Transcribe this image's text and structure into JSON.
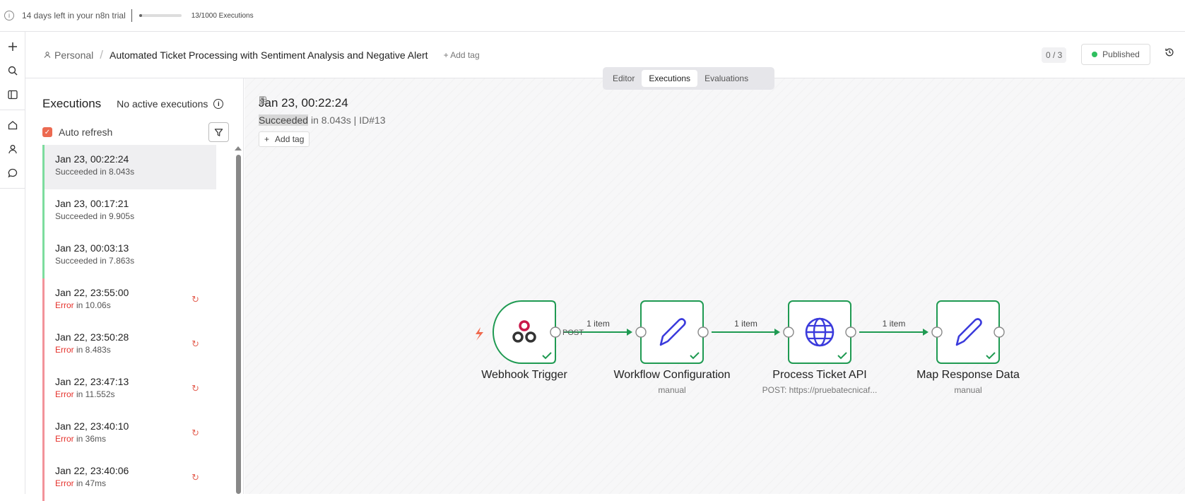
{
  "trial": {
    "message": "14 days left in your n8n trial",
    "executions_used": 13,
    "executions_limit": 1000,
    "executions_text": "13/1000 Executions"
  },
  "rail": {
    "icons": [
      "plus-icon",
      "search-icon",
      "panel-icon",
      "home-icon",
      "user-icon",
      "chat-icon"
    ]
  },
  "header": {
    "project": "Personal",
    "workflow_title": "Automated Ticket Processing with Sentiment Analysis and Negative Alert",
    "add_tag": "+ Add tag",
    "counter": "0 / 3",
    "published": "Published"
  },
  "tabs": [
    {
      "label": "Editor",
      "active": false
    },
    {
      "label": "Executions",
      "active": true
    },
    {
      "label": "Evaluations",
      "active": false
    }
  ],
  "sidebar": {
    "title": "Executions",
    "no_active": "No active executions",
    "auto_refresh": "Auto refresh",
    "auto_refresh_checked": true,
    "executions": [
      {
        "date": "Jan 23, 00:22:24",
        "status": "Succeeded",
        "detail": "Succeeded in 8.043s",
        "selected": true
      },
      {
        "date": "Jan 23, 00:17:21",
        "status": "Succeeded",
        "detail": "Succeeded in 9.905s",
        "selected": false
      },
      {
        "date": "Jan 23, 00:03:13",
        "status": "Succeeded",
        "detail": "Succeeded in 7.863s",
        "selected": false
      },
      {
        "date": "Jan 22, 23:55:00",
        "status": "Error",
        "detail": " in 10.06s",
        "selected": false
      },
      {
        "date": "Jan 22, 23:50:28",
        "status": "Error",
        "detail": " in 8.483s",
        "selected": false
      },
      {
        "date": "Jan 22, 23:47:13",
        "status": "Error",
        "detail": " in 11.552s",
        "selected": false
      },
      {
        "date": "Jan 22, 23:40:10",
        "status": "Error",
        "detail": " in 36ms",
        "selected": false
      },
      {
        "date": "Jan 22, 23:40:06",
        "status": "Error",
        "detail": " in 47ms",
        "selected": false
      }
    ]
  },
  "run": {
    "date": "Jan 23, 00:22:24",
    "status_word": "Succeeded",
    "status_rest": " in 8.043s | ID#13",
    "add_tag": "Add tag"
  },
  "workflow": {
    "accent": "#1f9a52",
    "nodes": [
      {
        "name": "Webhook Trigger",
        "subtitle": "",
        "icon": "webhook-icon"
      },
      {
        "name": "Workflow Configuration",
        "subtitle": "manual",
        "icon": "pencil-icon"
      },
      {
        "name": "Process Ticket API",
        "subtitle": "POST: https://pruebatecnicaf...",
        "icon": "globe-icon"
      },
      {
        "name": "Map Response Data",
        "subtitle": "manual",
        "icon": "pencil-icon"
      }
    ],
    "connections": [
      {
        "label": "1 item",
        "from_label": "POST"
      },
      {
        "label": "1 item",
        "from_label": ""
      },
      {
        "label": "1 item",
        "from_label": ""
      }
    ]
  }
}
